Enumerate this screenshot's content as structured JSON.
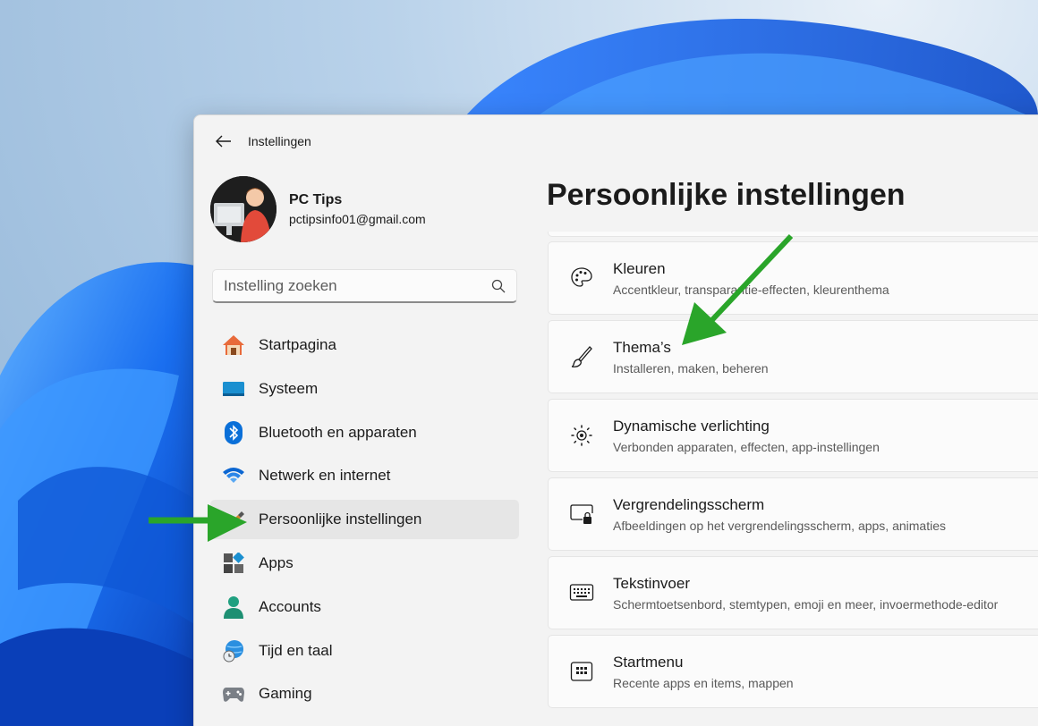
{
  "window": {
    "title": "Instellingen"
  },
  "profile": {
    "name": "PC Tips",
    "email": "pctipsinfo01@gmail.com"
  },
  "search": {
    "placeholder": "Instelling zoeken"
  },
  "nav": {
    "items": [
      {
        "label": "Startpagina",
        "icon": "home-icon"
      },
      {
        "label": "Systeem",
        "icon": "system-icon"
      },
      {
        "label": "Bluetooth en apparaten",
        "icon": "bluetooth-icon"
      },
      {
        "label": "Netwerk en internet",
        "icon": "wifi-icon"
      },
      {
        "label": "Persoonlijke instellingen",
        "icon": "personalization-icon",
        "active": true
      },
      {
        "label": "Apps",
        "icon": "apps-icon"
      },
      {
        "label": "Accounts",
        "icon": "accounts-icon"
      },
      {
        "label": "Tijd en taal",
        "icon": "time-language-icon"
      },
      {
        "label": "Gaming",
        "icon": "gaming-icon"
      }
    ]
  },
  "main": {
    "title": "Persoonlijke instellingen",
    "cards": [
      {
        "title": "Kleuren",
        "subtitle": "Accentkleur, transparantie-effecten, kleurenthema",
        "icon": "palette-icon"
      },
      {
        "title": "Thema’s",
        "subtitle": "Installeren, maken, beheren",
        "icon": "brush-icon"
      },
      {
        "title": "Dynamische verlichting",
        "subtitle": "Verbonden apparaten, effecten, app-instellingen",
        "icon": "lighting-icon"
      },
      {
        "title": "Vergrendelingsscherm",
        "subtitle": "Afbeeldingen op het vergrendelingsscherm, apps, animaties",
        "icon": "lockscreen-icon"
      },
      {
        "title": "Tekstinvoer",
        "subtitle": "Schermtoetsenbord, stemtypen, emoji en meer, invoermethode-editor",
        "icon": "keyboard-icon"
      },
      {
        "title": "Startmenu",
        "subtitle": "Recente apps en items, mappen",
        "icon": "start-icon"
      }
    ]
  },
  "colors": {
    "accent": "#0067c0",
    "arrow": "#2aa52a"
  }
}
